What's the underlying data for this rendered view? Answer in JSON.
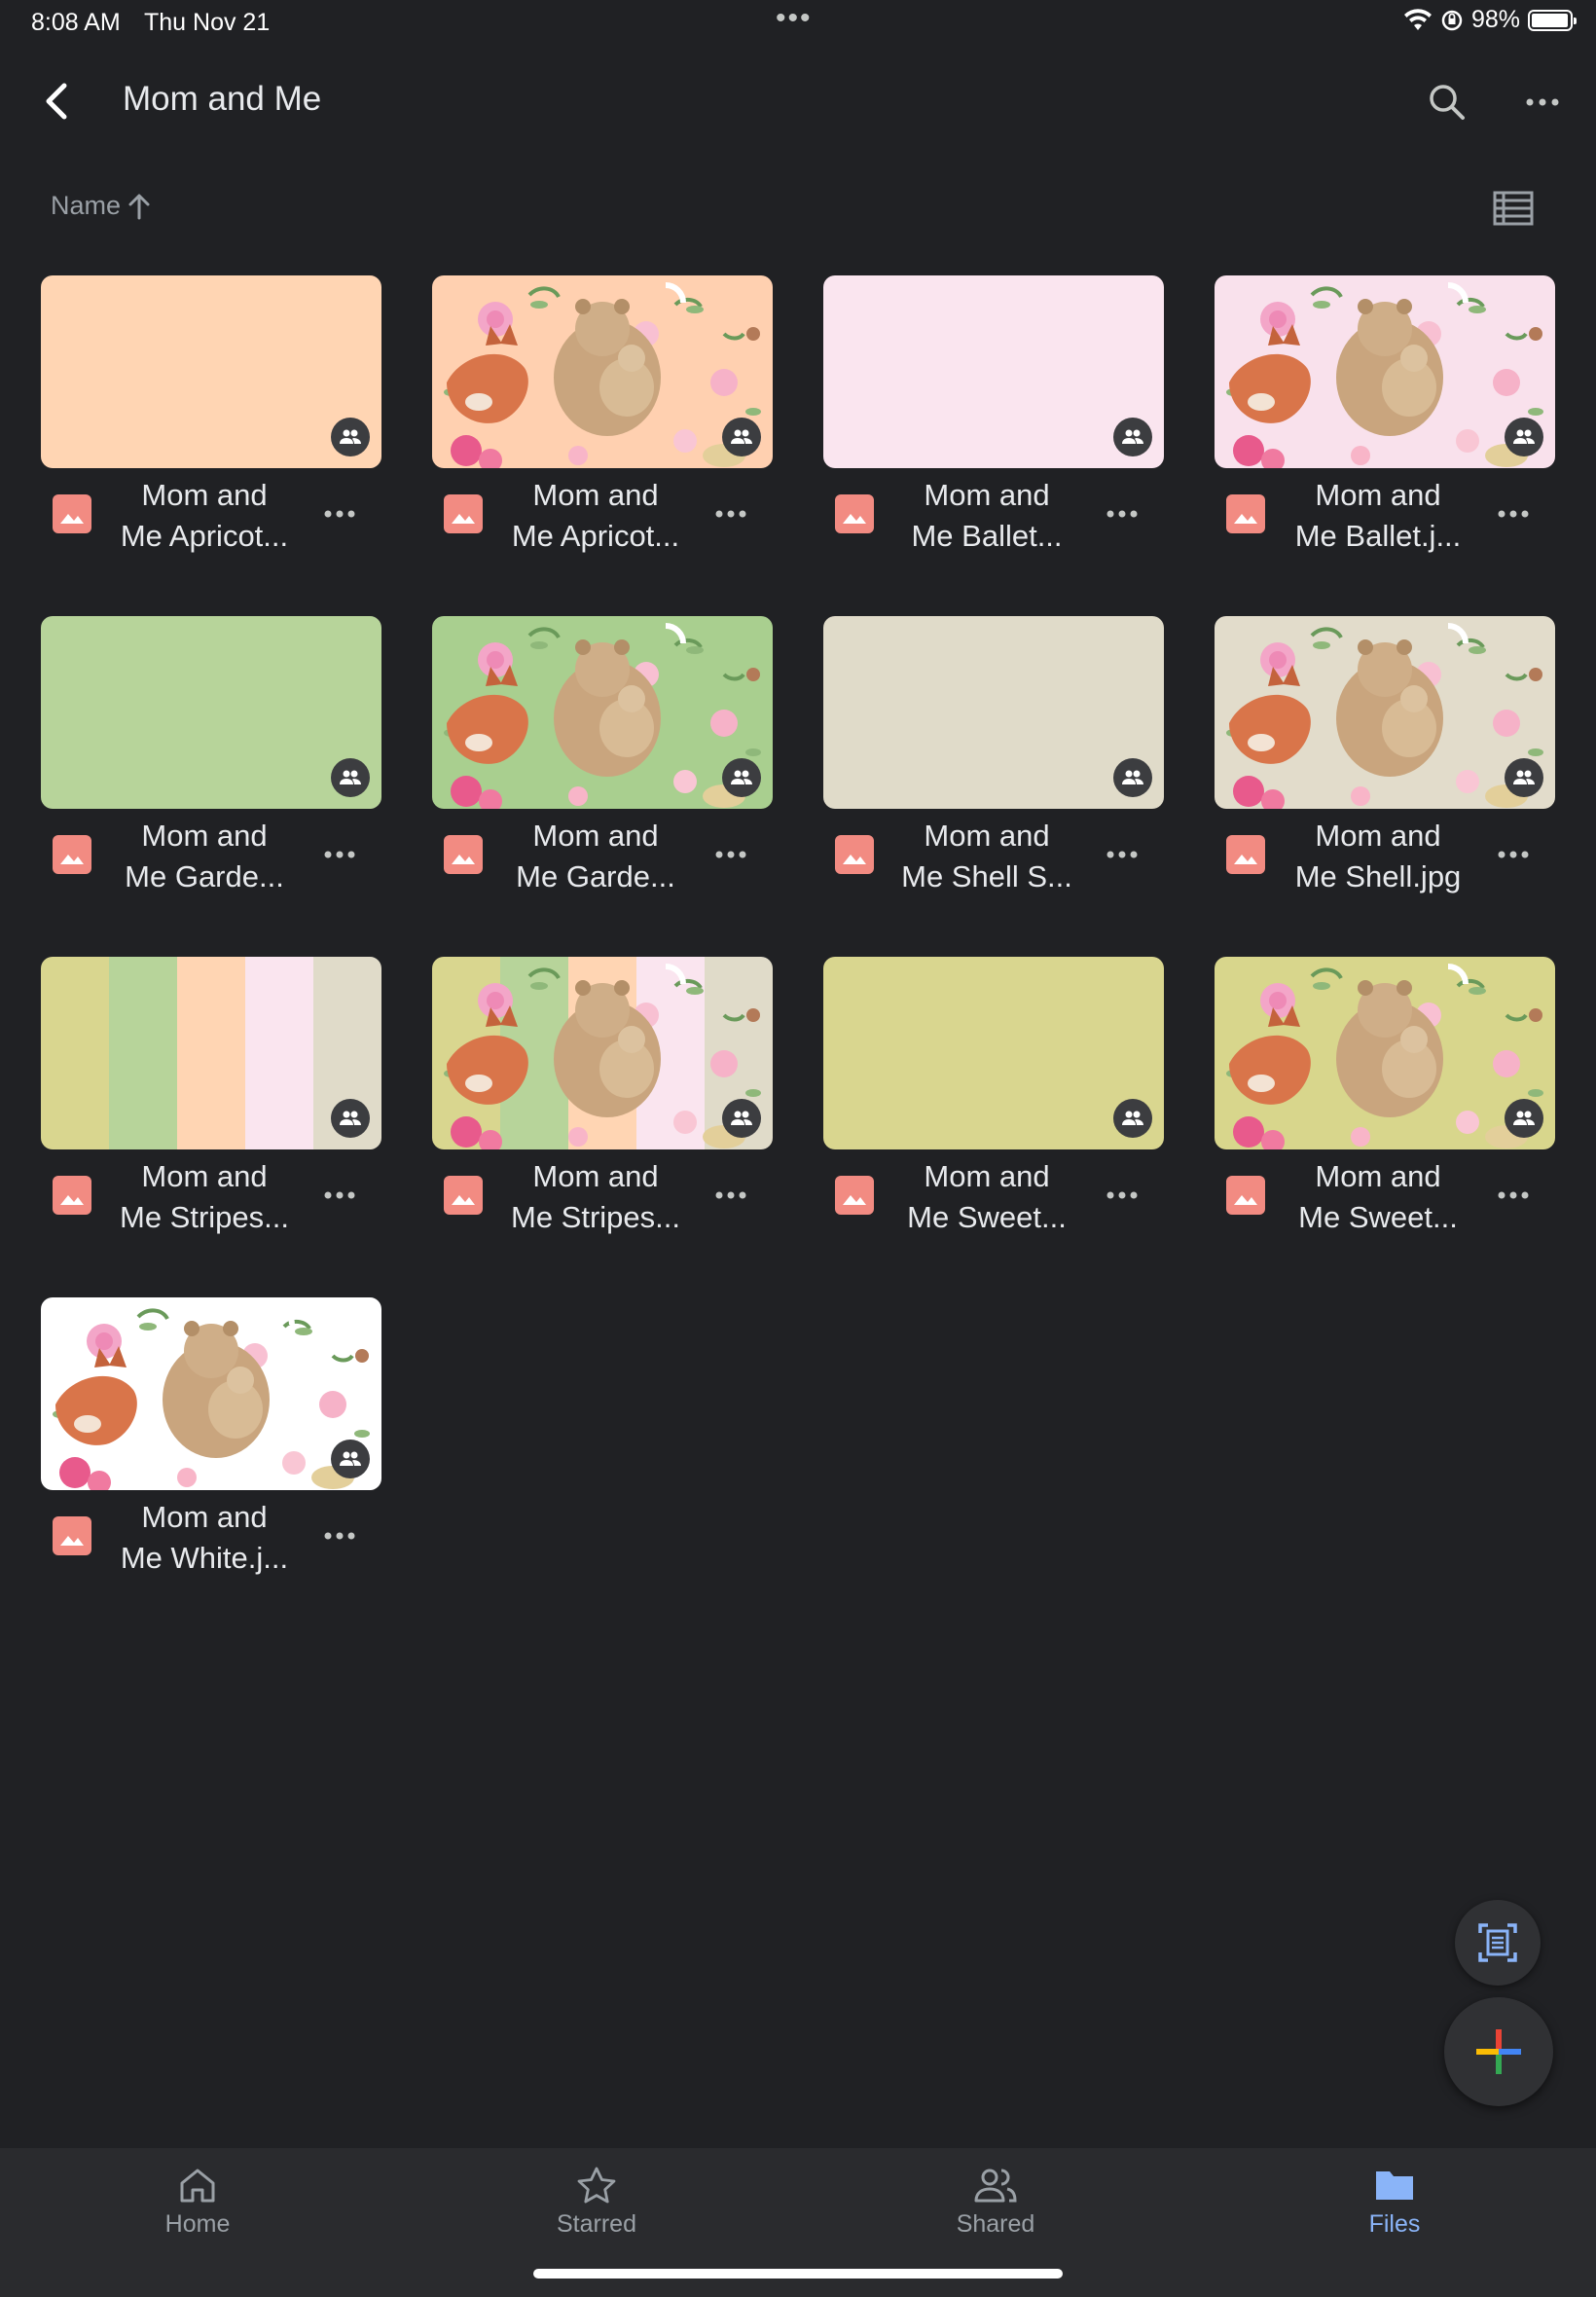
{
  "status_bar": {
    "time": "8:08 AM",
    "date": "Thu Nov 21",
    "dots": "•••",
    "battery": "98%",
    "battery_level": 0.98
  },
  "app_bar": {
    "title": "Mom and Me",
    "icons": [
      "back-arrow-icon",
      "search-icon",
      "more-vert-icon"
    ]
  },
  "sort": {
    "label": "Name",
    "direction": "ascending",
    "view_icon": "list-view-icon"
  },
  "files": [
    {
      "name": "Mom and\nMe Apricot...",
      "thumb": "solid",
      "color": "#ffd5b3"
    },
    {
      "name": "Mom and\nMe Apricot...",
      "thumb": "pattern",
      "color": "#ffd0b0"
    },
    {
      "name": "Mom and\nMe Ballet...",
      "thumb": "solid",
      "color": "#fae5ef"
    },
    {
      "name": "Mom and\nMe Ballet.j...",
      "thumb": "pattern",
      "color": "#f9e1ec"
    },
    {
      "name": "Mom and\nMe Garde...",
      "thumb": "solid",
      "color": "#b7d49a"
    },
    {
      "name": "Mom and\nMe Garde...",
      "thumb": "pattern",
      "color": "#a9cf8f"
    },
    {
      "name": "Mom and\nMe Shell S...",
      "thumb": "solid",
      "color": "#e0dbc9"
    },
    {
      "name": "Mom and\nMe Shell.jpg",
      "thumb": "pattern",
      "color": "#e2dccb"
    },
    {
      "name": "Mom and\nMe Stripes...",
      "thumb": "stripes",
      "color": "#d9d68f"
    },
    {
      "name": "Mom and\nMe Stripes...",
      "thumb": "pattern-stripes",
      "color": "#c8d78f"
    },
    {
      "name": "Mom and\nMe Sweet...",
      "thumb": "solid",
      "color": "#d9d68f"
    },
    {
      "name": "Mom and\nMe Sweet...",
      "thumb": "pattern",
      "color": "#d8d68c"
    },
    {
      "name": "Mom and\nMe White.j...",
      "thumb": "pattern",
      "color": "#ffffff"
    }
  ],
  "stripe_colors": [
    "#d9d68f",
    "#b7d49a",
    "#ffd5b3",
    "#fae5ef",
    "#e0dbc9"
  ],
  "fab": {
    "scan_icon": "document-scan-icon",
    "add_icon": "plus-icon"
  },
  "bottom_nav": [
    {
      "label": "Home",
      "icon": "home-icon",
      "active": false
    },
    {
      "label": "Starred",
      "icon": "star-icon",
      "active": false
    },
    {
      "label": "Shared",
      "icon": "people-icon",
      "active": false
    },
    {
      "label": "Files",
      "icon": "folder-icon",
      "active": true
    }
  ],
  "colors": {
    "background": "#202124",
    "accent": "#8ab4f8",
    "image_icon": "#f28b82"
  }
}
